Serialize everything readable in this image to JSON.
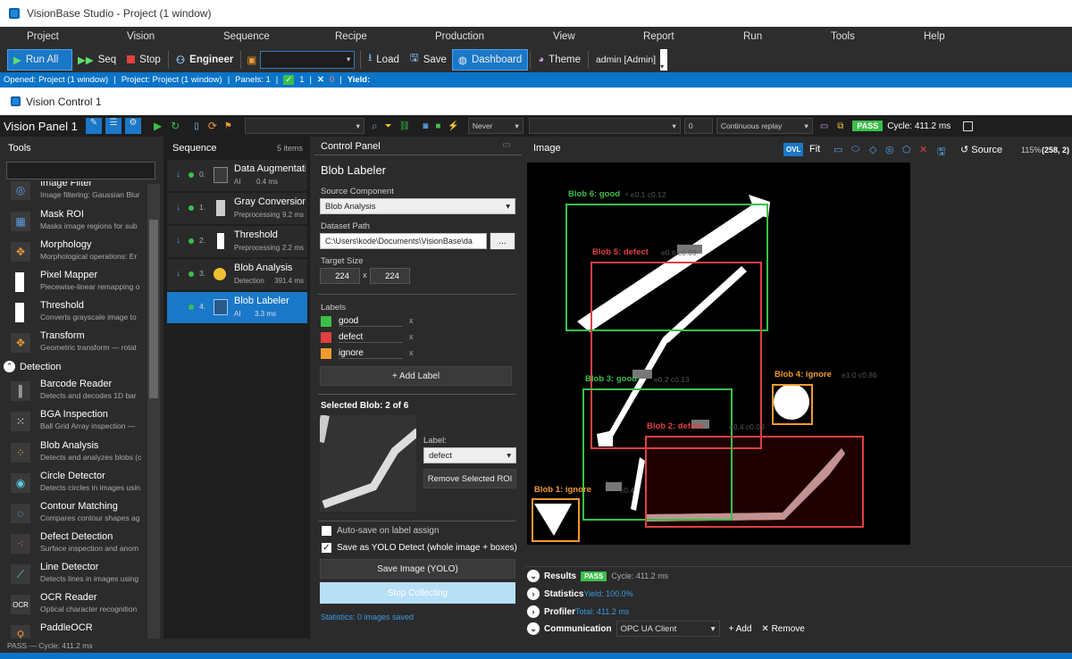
{
  "window": {
    "title": "VisionBase Studio - Project (1 window)"
  },
  "menu": [
    "Project",
    "Vision",
    "Sequence",
    "Recipe",
    "Production",
    "View",
    "Report",
    "Run",
    "Tools",
    "Help"
  ],
  "toolbar": {
    "run_all": "Run All",
    "seq": "Seq",
    "stop": "Stop",
    "engineer": "Engineer",
    "load": "Load",
    "save": "Save",
    "dashboard": "Dashboard",
    "theme": "Theme",
    "user": "admin  [Admin]"
  },
  "status": {
    "opened": "Opened: Project (1 window)",
    "project": "Project: Project (1 window)",
    "panels": "Panels: 1",
    "pass_count": "1",
    "fail_count": "0",
    "yield_label": "Yield:"
  },
  "tab": {
    "title": "Vision Control 1"
  },
  "panel": {
    "title": "Vision Panel 1",
    "trigger": "Never",
    "value": "0",
    "replay": "Continuous replay",
    "result": "PASS",
    "cycle": "Cycle: 411.2 ms"
  },
  "tools": {
    "header": "Tools",
    "items": [
      {
        "name": "Image Filter",
        "desc": "Image filtering: Gaussian Blur"
      },
      {
        "name": "Mask ROI",
        "desc": "Masks image regions for sub"
      },
      {
        "name": "Morphology",
        "desc": "Morphological operations: Er"
      },
      {
        "name": "Pixel Mapper",
        "desc": "Piecewise-linear remapping o"
      },
      {
        "name": "Threshold",
        "desc": "Converts grayscale image to"
      },
      {
        "name": "Transform",
        "desc": "Geometric transform — rotat"
      }
    ],
    "category": "Detection",
    "detection": [
      {
        "name": "Barcode Reader",
        "desc": "Detects and decodes 1D bar"
      },
      {
        "name": "BGA Inspection",
        "desc": "Ball Grid Array inspection —"
      },
      {
        "name": "Blob Analysis",
        "desc": "Detects and analyzes blobs (c"
      },
      {
        "name": "Circle Detector",
        "desc": "Detects circles in images usin"
      },
      {
        "name": "Contour Matching",
        "desc": "Compares contour shapes ag"
      },
      {
        "name": "Defect Detection",
        "desc": "Surface inspection and anom"
      },
      {
        "name": "Line Detector",
        "desc": "Detects lines in images using"
      },
      {
        "name": "OCR Reader",
        "desc": "Optical character recognition"
      },
      {
        "name": "PaddleOCR",
        "desc": ""
      }
    ]
  },
  "sequence": {
    "header": "Sequence",
    "count": "5 items",
    "items": [
      {
        "num": "0.",
        "name": "Data Augmentation",
        "cat": "AI",
        "time": "0.4 ms"
      },
      {
        "num": "1.",
        "name": "Gray Conversion",
        "cat": "Preprocessing",
        "time": "9.2 ms"
      },
      {
        "num": "2.",
        "name": "Threshold",
        "cat": "Preprocessing",
        "time": "2.2 ms"
      },
      {
        "num": "3.",
        "name": "Blob Analysis",
        "cat": "Detection",
        "time": "391.4 ms"
      },
      {
        "num": "4.",
        "name": "Blob Labeler",
        "cat": "AI",
        "time": "3.3 ms"
      }
    ]
  },
  "control": {
    "header": "Control Panel",
    "title": "Blob Labeler",
    "source_label": "Source Component",
    "source_value": "Blob Analysis",
    "dataset_label": "Dataset Path",
    "dataset_value": "C:\\Users\\kode\\Documents\\VisionBase\\da",
    "browse": "...",
    "target_label": "Target Size",
    "target_w": "224",
    "target_x": "x",
    "target_h": "224",
    "labels_label": "Labels",
    "labels": [
      {
        "name": "good",
        "color": "#3bbf4a"
      },
      {
        "name": "defect",
        "color": "#e04040"
      },
      {
        "name": "ignore",
        "color": "#f09a30"
      }
    ],
    "remove_x": "x",
    "add_label": "+ Add Label",
    "selected_blob": "Selected Blob: 2 of 6",
    "label_caption": "Label:",
    "label_value": "defect",
    "remove_selected": "Remove Selected ROI",
    "autosave": "Auto-save on label assign",
    "yolo": "Save as YOLO Detect (whole image + boxes)",
    "save_image": "Save Image (YOLO)",
    "stop_collecting": "Stop Collecting",
    "statistics": "Statistics: 0 images saved"
  },
  "image": {
    "header": "Image",
    "ovl": "OVL",
    "fit": "Fit",
    "source": "Source",
    "zoom": "115%",
    "coords": "(258, 2)",
    "blobs": [
      {
        "label": "Blob 6: good",
        "extra": "⁶ e0.1 c0.12",
        "color": "#3bbf4a"
      },
      {
        "label": "Blob 5: defect",
        "extra": "e0.6 c0.09",
        "color": "#e04040"
      },
      {
        "label": "Blob 4: ignore",
        "extra": "e1.0 c0.86",
        "color": "#f09a30"
      },
      {
        "label": "Blob 3: good",
        "extra": "e0.2 c0.13",
        "color": "#3bbf4a"
      },
      {
        "label": "Blob 2: defect",
        "extra": "e0.4 c0.09",
        "color": "#e04040"
      },
      {
        "label": "Blob 1: ignore",
        "extra": "c0.4",
        "color": "#f09a30"
      }
    ]
  },
  "results": {
    "results_label": "Results",
    "result_badge": "PASS",
    "cycle": "Cycle: 411.2 ms",
    "statistics_label": "Statistics",
    "yield": "Yield:  100.0%",
    "profiler_label": "Profiler",
    "total": "Total: 411.2 ms",
    "comm_label": "Communication",
    "comm_value": "OPC UA Client",
    "add": "+ Add",
    "remove": "✕ Remove"
  },
  "footer": {
    "status": "PASS — Cycle: 411.2 ms"
  }
}
